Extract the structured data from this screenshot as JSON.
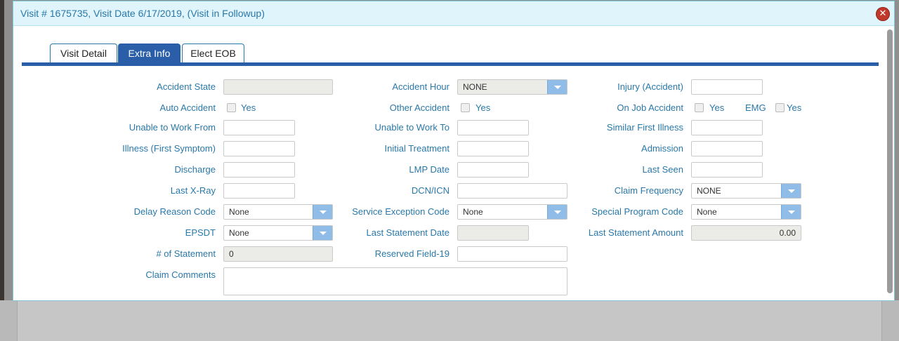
{
  "window": {
    "title": "Visit # 1675735, Visit Date 6/17/2019, (Visit in Followup)"
  },
  "tabs": [
    {
      "label": "Visit Detail"
    },
    {
      "label": "Extra Info"
    },
    {
      "label": "Elect EOB"
    }
  ],
  "active_tab": "Extra Info",
  "form": {
    "accident_state": {
      "label": "Accident State",
      "value": ""
    },
    "accident_hour": {
      "label": "Accident Hour",
      "value": "NONE"
    },
    "injury_accident": {
      "label": "Injury (Accident)",
      "value": ""
    },
    "auto_accident": {
      "label": "Auto Accident",
      "option": "Yes"
    },
    "other_accident": {
      "label": "Other Accident",
      "option": "Yes"
    },
    "on_job_accident": {
      "label": "On Job Accident",
      "option": "Yes"
    },
    "emg": {
      "label": "EMG",
      "option": "Yes"
    },
    "unable_to_work_from": {
      "label": "Unable to Work From",
      "value": ""
    },
    "unable_to_work_to": {
      "label": "Unable to Work To",
      "value": ""
    },
    "similar_first_illness": {
      "label": "Similar First Illness",
      "value": ""
    },
    "illness_first_symptom": {
      "label": "Illness (First Symptom)",
      "value": ""
    },
    "initial_treatment": {
      "label": "Initial Treatment",
      "value": ""
    },
    "admission": {
      "label": "Admission",
      "value": ""
    },
    "discharge": {
      "label": "Discharge",
      "value": ""
    },
    "lmp_date": {
      "label": "LMP Date",
      "value": ""
    },
    "last_seen": {
      "label": "Last Seen",
      "value": ""
    },
    "last_xray": {
      "label": "Last X-Ray",
      "value": ""
    },
    "dcn_icn": {
      "label": "DCN/ICN",
      "value": ""
    },
    "claim_frequency": {
      "label": "Claim Frequency",
      "value": "NONE"
    },
    "delay_reason_code": {
      "label": "Delay Reason Code",
      "value": "None"
    },
    "service_exception_code": {
      "label": "Service Exception Code",
      "value": "None"
    },
    "special_program_code": {
      "label": "Special Program Code",
      "value": "None"
    },
    "epsdt": {
      "label": "EPSDT",
      "value": "None"
    },
    "last_statement_date": {
      "label": "Last Statement Date",
      "value": ""
    },
    "last_statement_amount": {
      "label": "Last Statement Amount",
      "value": "0.00"
    },
    "num_statement": {
      "label": "# of Statement",
      "value": "0"
    },
    "reserved_field_19": {
      "label": "Reserved Field-19",
      "value": ""
    },
    "claim_comments": {
      "label": "Claim Comments",
      "value": ""
    }
  },
  "icons": {
    "close": "close-icon"
  }
}
